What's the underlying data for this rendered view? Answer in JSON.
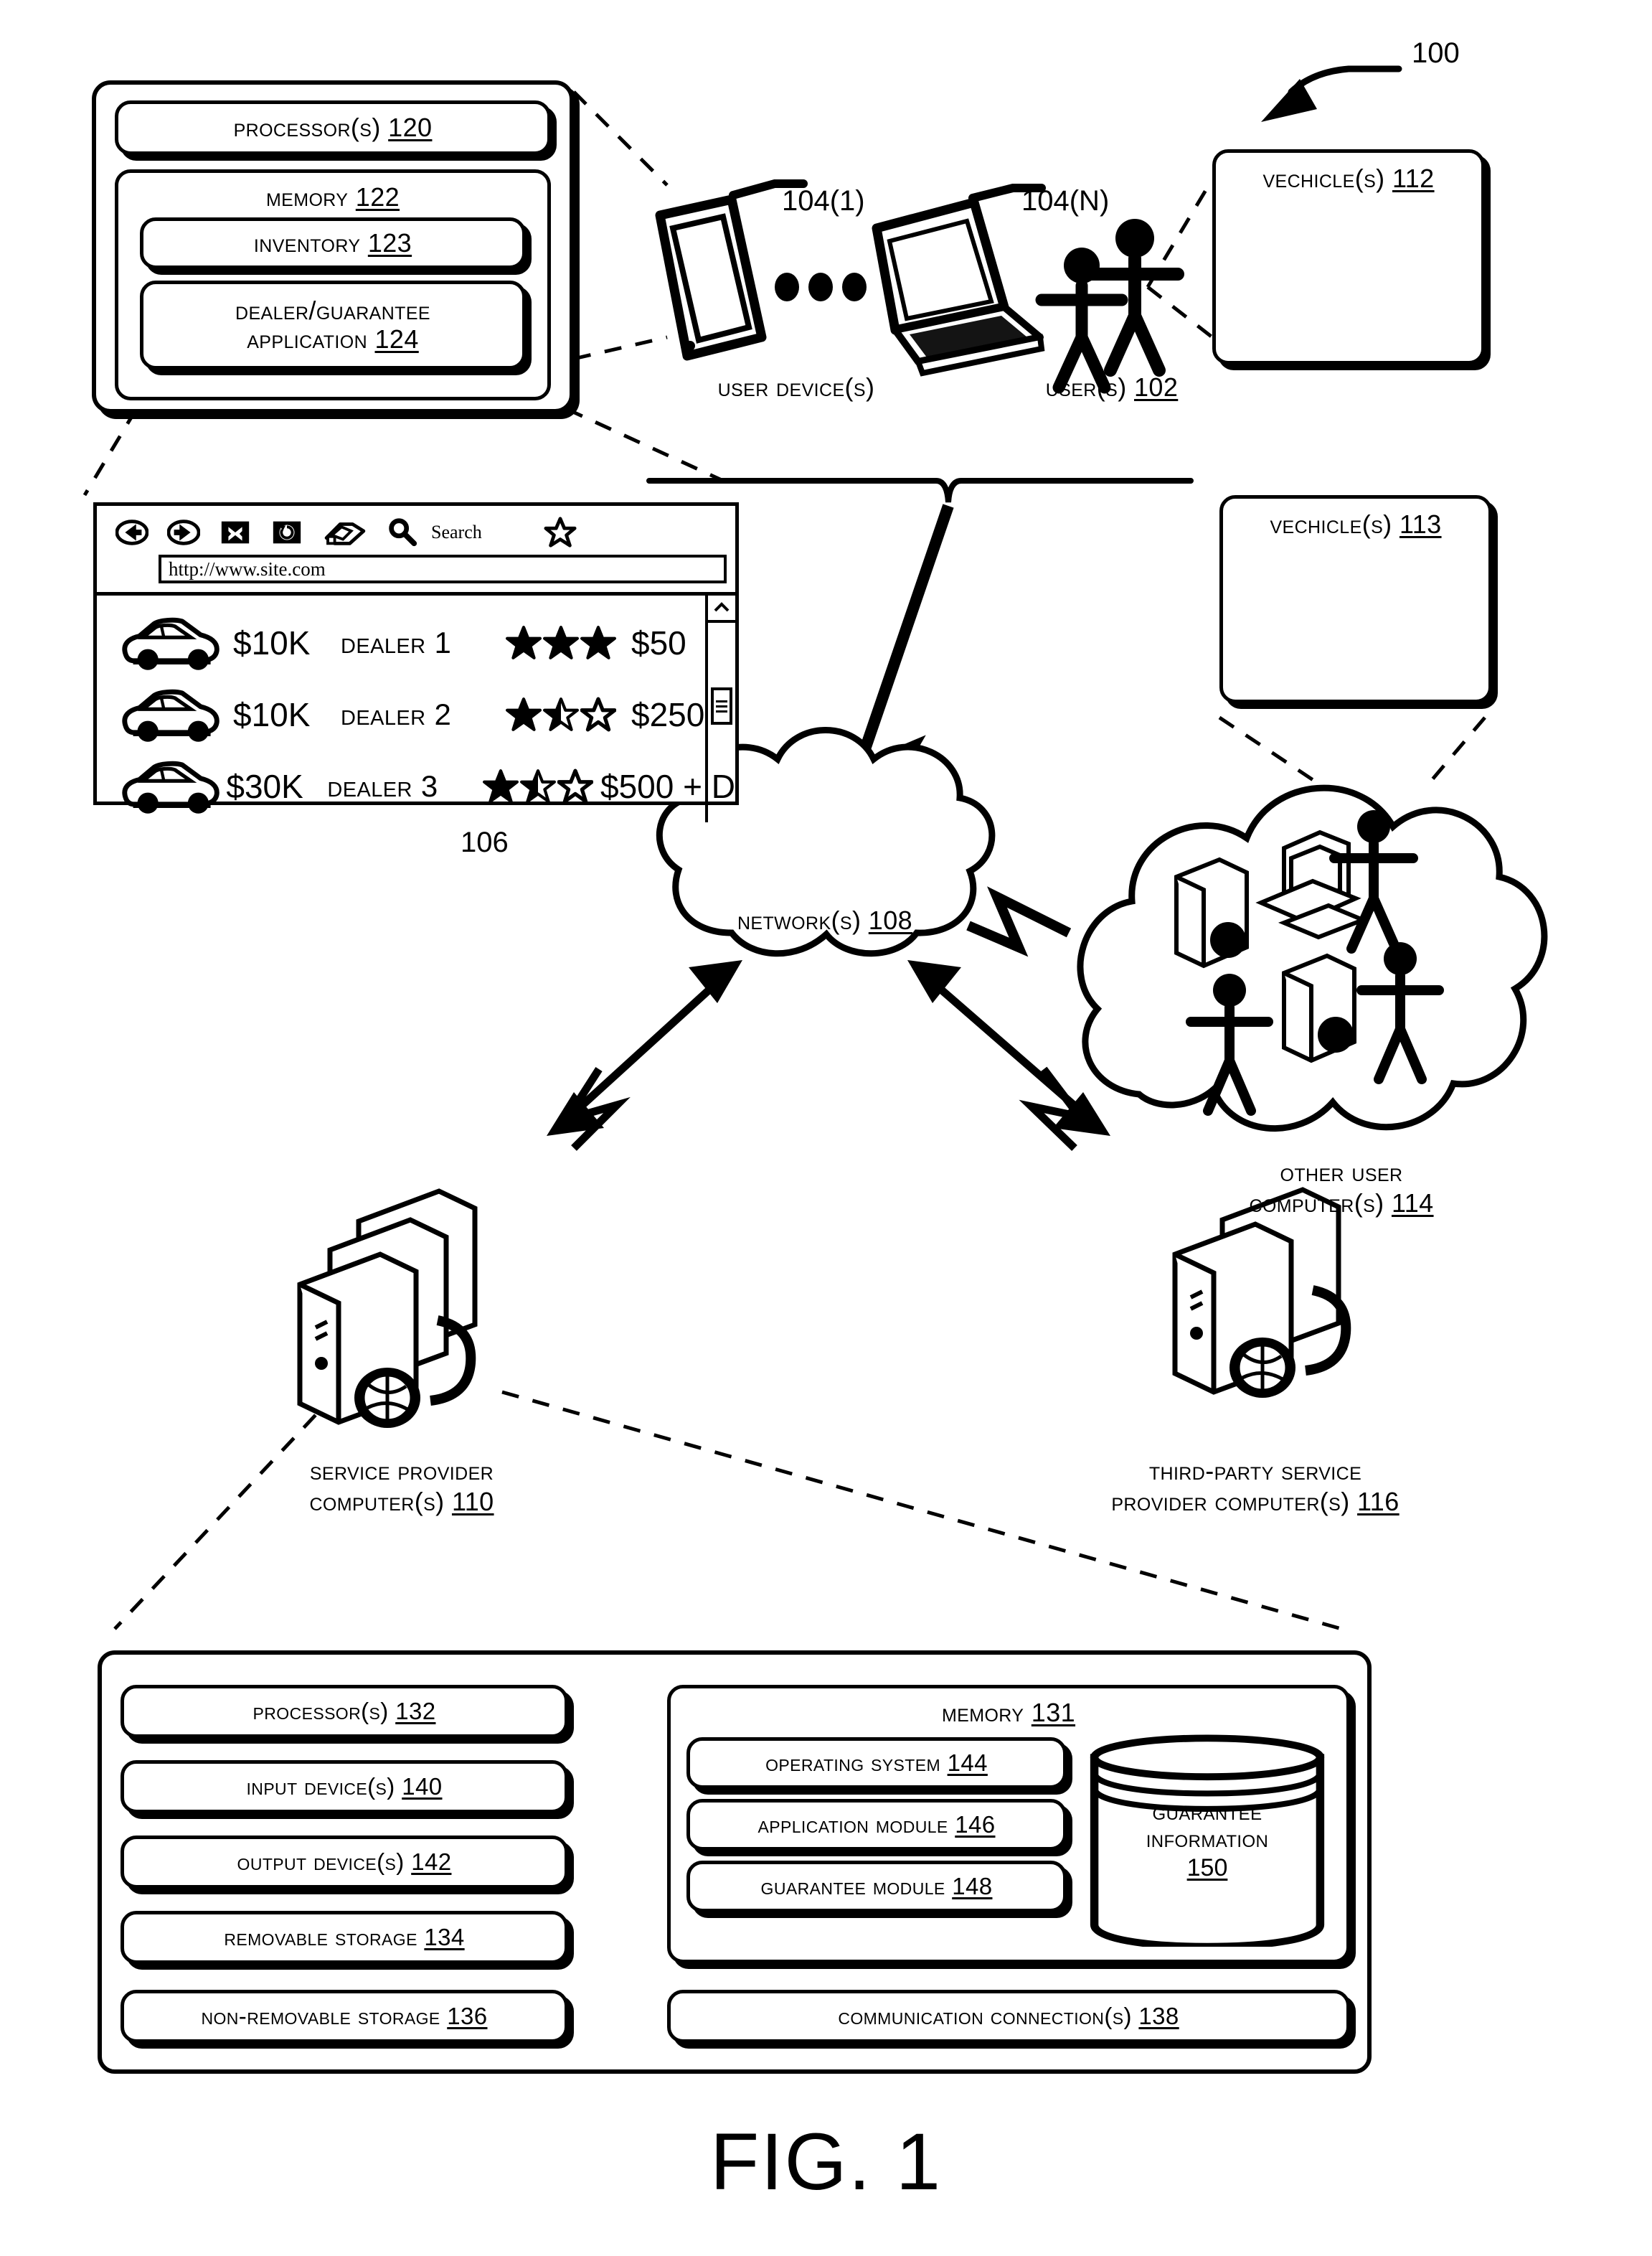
{
  "figure": {
    "caption": "FIG. 1",
    "system_ref": "100"
  },
  "user_device_box": {
    "processor": "Processor(s) 120",
    "memory": "Memory 122",
    "inventory": "Inventory 123",
    "dealer_app_line1": "Dealer/Guarantee",
    "dealer_app_line2": "Application 124"
  },
  "devices": {
    "tablet_ref": "104(1)",
    "laptop_ref": "104(N)",
    "devices_label": "User Device(s)",
    "users_label": "User(s) 102",
    "ellipsis": "•••"
  },
  "vehicles_112": {
    "label": "Vechicle(s) 112"
  },
  "vehicles_113": {
    "label": "Vechicle(s) 113"
  },
  "browser": {
    "ref": "106",
    "url": "http://www.site.com",
    "search_label": "Search",
    "toolbar_icons": [
      "back-icon",
      "forward-icon",
      "stop-icon",
      "reload-icon",
      "home-icon",
      "search-icon",
      "favorites-star-icon"
    ],
    "columns": [
      "vehicle",
      "price",
      "dealer",
      "rating",
      "fee"
    ],
    "listings": [
      {
        "price": "$10K",
        "dealer": "Dealer 1",
        "stars_filled": 3,
        "stars_half": 0,
        "stars_empty": 0,
        "fee": "$50"
      },
      {
        "price": "$10K",
        "dealer": "Dealer 2",
        "stars_filled": 1,
        "stars_half": 1,
        "stars_empty": 1,
        "fee": "$250"
      },
      {
        "price": "$30K",
        "dealer": "Dealer 3",
        "stars_filled": 1,
        "stars_half": 1,
        "stars_empty": 1,
        "fee": "$500 + D"
      }
    ]
  },
  "network": {
    "label": "Network(s) 108"
  },
  "other_users_cloud": {
    "line1": "Other User",
    "line2": "Computer(s) 114"
  },
  "service_provider": {
    "line1": "Service Provider",
    "line2": "Computer(s) 110"
  },
  "third_party": {
    "line1": "Third-Party Service",
    "line2": "Provider Computer(s) 116"
  },
  "detail_box": {
    "left_items": [
      "Processor(s) 132",
      "Input Device(s) 140",
      "Output Device(s) 142",
      "Removable Storage 134",
      "Non-removable Storage 136"
    ],
    "memory_title": "Memory 131",
    "memory_items": [
      "Operating System 144",
      "Application Module 146",
      "Guarantee Module 148"
    ],
    "database_line1": "Guarantee",
    "database_line2": "Information",
    "database_line3": "150",
    "comm_label": "Communication Connection(s) 138"
  },
  "colors": {
    "ink": "#000000",
    "paper": "#ffffff"
  }
}
